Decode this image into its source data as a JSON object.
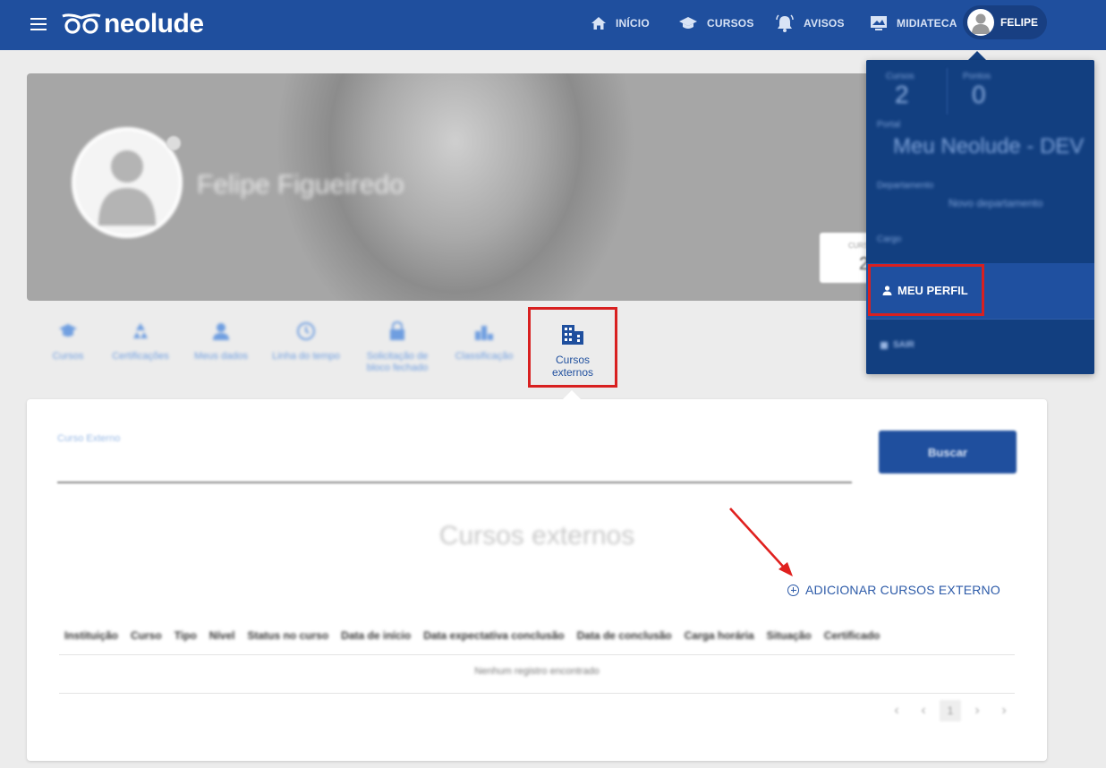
{
  "header": {
    "logo_text": "neolude",
    "nav": [
      {
        "label": "INÍCIO",
        "icon": "home-icon"
      },
      {
        "label": "CURSOS",
        "icon": "graduation-cap-icon"
      },
      {
        "label": "AVISOS",
        "icon": "bell-icon"
      },
      {
        "label": "MIDIATECA",
        "icon": "media-library-icon"
      }
    ],
    "user_name": "FELIPE"
  },
  "profile": {
    "name": "Felipe Figueiredo",
    "card_label": "CURS",
    "card_value": "2"
  },
  "tabs": [
    {
      "label": "Cursos"
    },
    {
      "label": "Certificações"
    },
    {
      "label": "Meus dados"
    },
    {
      "label": "Linha do tempo"
    },
    {
      "label": "Solicitação de bloco fechado"
    },
    {
      "label": "Classificação"
    }
  ],
  "active_tab": {
    "label": "Cursos externos"
  },
  "content": {
    "field_label": "Curso Externo",
    "search_button": "Buscar",
    "section_title": "Cursos externos",
    "add_link": "ADICIONAR CURSOS EXTERNO",
    "table_headers": [
      "Instituição",
      "Curso",
      "Tipo",
      "Nível",
      "Status no curso",
      "Data de início",
      "Data expectativa conclusão",
      "Data de conclusão",
      "Carga horária",
      "Situação",
      "Certificado"
    ],
    "empty_message": "Nenhum registro encontrado",
    "current_page": "1"
  },
  "dropdown": {
    "stats": [
      {
        "label": "Cursos",
        "value": "2"
      },
      {
        "label": "Pontos",
        "value": "0"
      }
    ],
    "portal_label": "Portal",
    "portal_value": "Meu Neolude - DEV",
    "department_label": "Departamento",
    "department_value": "Novo departamento",
    "role_label": "Cargo",
    "profile_item": "MEU PERFIL",
    "logout_item": "SAIR"
  },
  "colors": {
    "header_bg": "#1f4f9e",
    "dropdown_bg": "#123f80",
    "highlight_border": "#d82020",
    "link": "#2c5aa8"
  }
}
